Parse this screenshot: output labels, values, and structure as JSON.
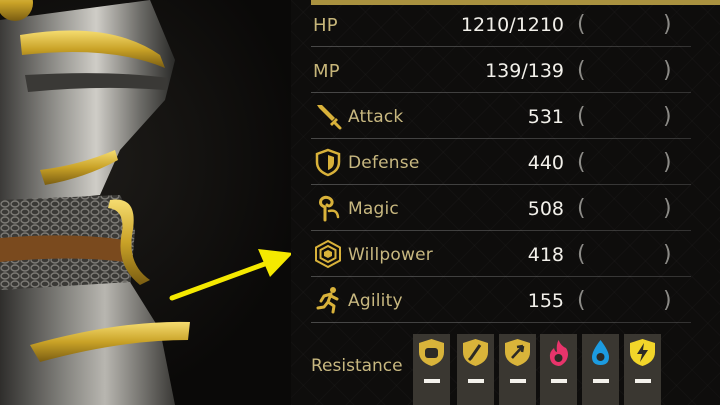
{
  "stats": [
    {
      "key": "hp",
      "label": "HP",
      "value": "1210/1210",
      "bonus": "",
      "icon": null
    },
    {
      "key": "mp",
      "label": "MP",
      "value": "139/139",
      "bonus": "",
      "icon": null
    },
    {
      "key": "attack",
      "label": "Attack",
      "value": "531",
      "bonus": "",
      "icon": "sword-icon"
    },
    {
      "key": "defense",
      "label": "Defense",
      "value": "440",
      "bonus": "",
      "icon": "shield-icon"
    },
    {
      "key": "magic",
      "label": "Magic",
      "value": "508",
      "bonus": "",
      "icon": "magic-swirl-icon"
    },
    {
      "key": "willpower",
      "label": "Willpower",
      "value": "418",
      "bonus": "",
      "icon": "hexagon-icon"
    },
    {
      "key": "agility",
      "label": "Agility",
      "value": "155",
      "bonus": "",
      "icon": "running-figure-icon"
    }
  ],
  "resistance": {
    "label": "Resistance",
    "items": [
      {
        "element": "strike",
        "icon": "fist-shield-icon",
        "color": "#d9b43a",
        "value": "–"
      },
      {
        "element": "slash",
        "icon": "blade-shield-icon",
        "color": "#d9b43a",
        "value": "–"
      },
      {
        "element": "pierce",
        "icon": "arrow-shield-icon",
        "color": "#d9b43a",
        "value": "–"
      },
      {
        "element": "fire",
        "icon": "flame-icon",
        "color": "#e8346b",
        "value": "–"
      },
      {
        "element": "ice",
        "icon": "water-drop-icon",
        "color": "#1c9be0",
        "value": "–"
      },
      {
        "element": "thunder",
        "icon": "lightning-icon",
        "color": "#f2d62a",
        "value": "–"
      }
    ]
  },
  "colors": {
    "gold": "#c8b880",
    "arrow": "#f5e900",
    "panel": "#0e0d0c"
  }
}
